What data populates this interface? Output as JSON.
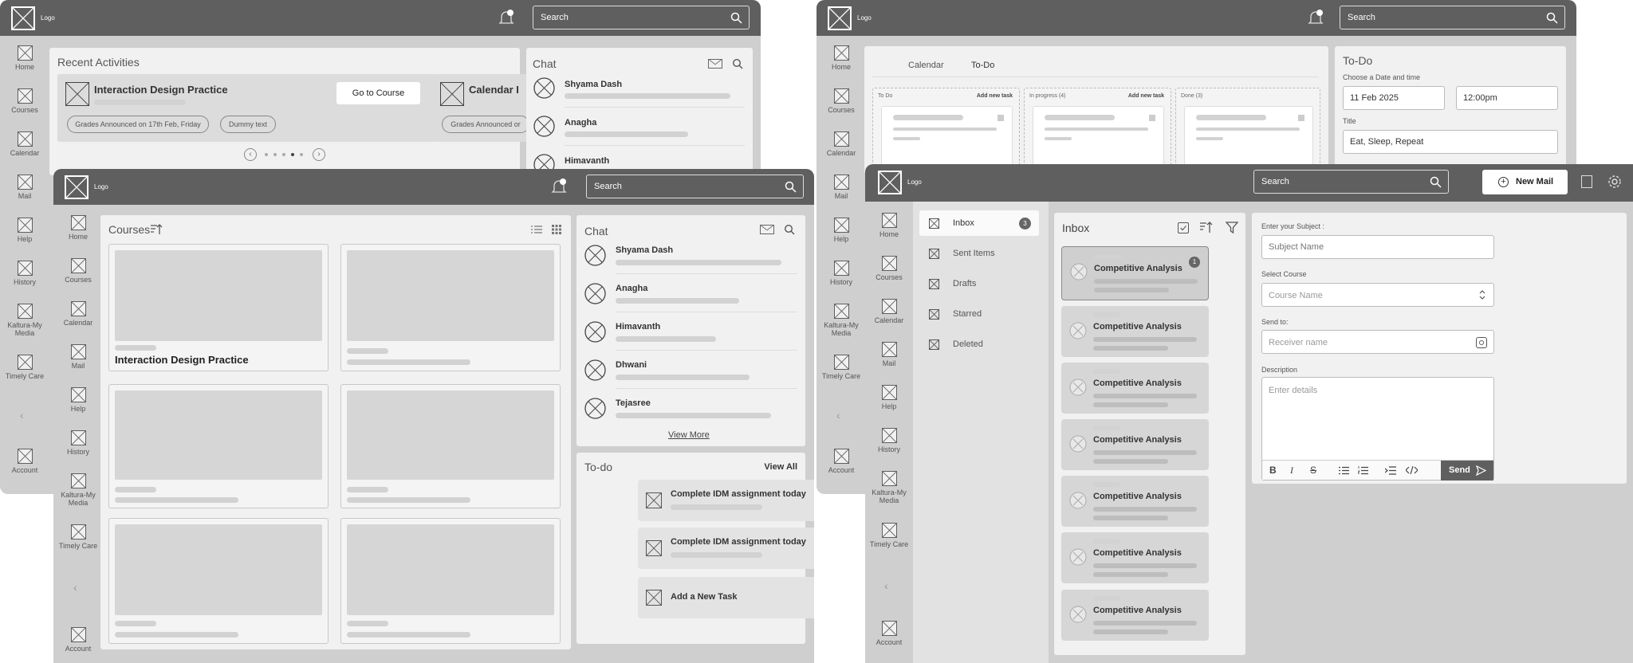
{
  "common": {
    "logo": "Logo",
    "search_placeholder": "Search",
    "bell_count": "1",
    "account": "Account"
  },
  "nav": [
    "Home",
    "Courses",
    "Calendar",
    "Mail",
    "Help",
    "History",
    "Kaltura-My Media",
    "Timely Care"
  ],
  "screen_a": {
    "recent_title": "Recent Activities",
    "course_title": "Interaction Design Practice",
    "go_button": "Go to Course",
    "pill_1": "Grades Announced on 17th Feb, Friday",
    "pill_2": "Dummy text",
    "second_course": "Calendar I",
    "second_pill": "Grades Announced or",
    "chat_title": "Chat",
    "chat": [
      "Shyama Dash",
      "Anagha",
      "Himavanth"
    ]
  },
  "screen_b": {
    "courses_title": "Courses",
    "first_course": "Interaction Design Practice",
    "chat_title": "Chat",
    "chat": [
      "Shyama Dash",
      "Anagha",
      "Himavanth",
      "Dhwani",
      "Tejasree"
    ],
    "view_more": "View More",
    "todo_title": "To-do",
    "view_all": "View All",
    "todo_1": "Complete IDM assignment today",
    "todo_2": "Complete IDM assignment today",
    "add_task": "Add a New Task"
  },
  "screen_c": {
    "tab_calendar": "Calendar",
    "tab_todo": "To-Do",
    "col_todo": "To Do",
    "col_progress": "In progress (4)",
    "col_done": "Done (3)",
    "add_new_task": "Add new task",
    "panel_title": "To-Do",
    "date_label": "Choose a Date and time",
    "date_value": "11 Feb 2025",
    "time_value": "12:00pm",
    "title_label": "Title",
    "title_value": "Eat, Sleep, Repeat"
  },
  "screen_d": {
    "new_mail": "New Mail",
    "folders": [
      "Inbox",
      "Sent Items",
      "Drafts",
      "Starred",
      "Deleted"
    ],
    "inbox_count": "3",
    "inbox_title": "Inbox",
    "mail_subject": "Competitive Analysis",
    "first_badge": "1",
    "subject_label": "Enter your Subject :",
    "subject_placeholder": "Subject Name",
    "course_label": "Select Course",
    "course_placeholder": "Course Name",
    "send_label": "Send to:",
    "send_placeholder": "Receiver name",
    "desc_label": "Description",
    "desc_placeholder": "Enter details",
    "send_button": "Send"
  }
}
